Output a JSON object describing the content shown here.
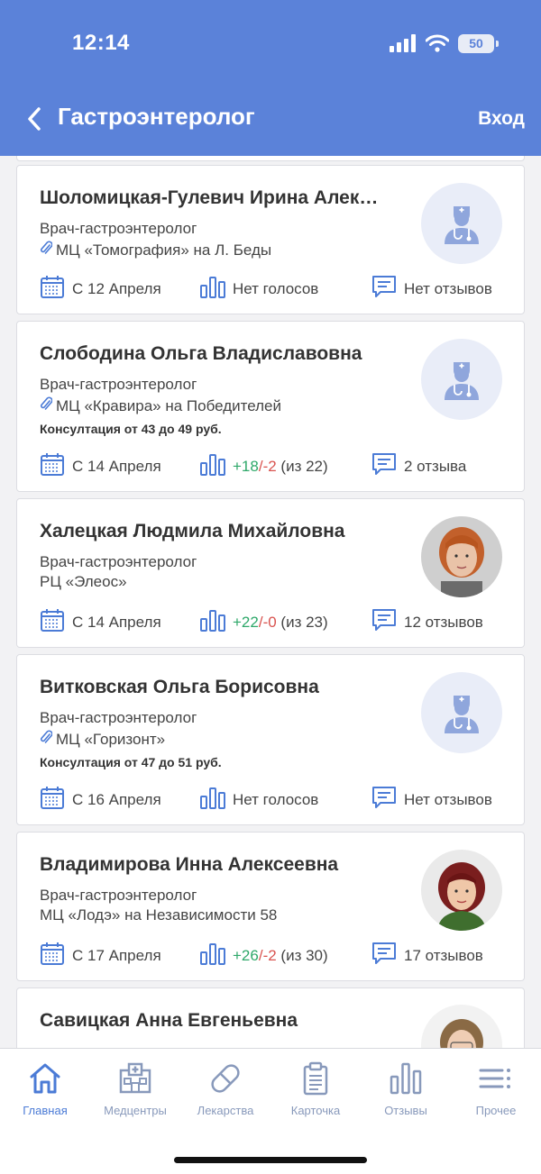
{
  "status_bar": {
    "time": "12:14",
    "battery": "50"
  },
  "nav": {
    "title": "Гастроэнтеролог",
    "login": "Вход"
  },
  "colors": {
    "header_bg": "#5b82d9",
    "accent": "#4b7bd6",
    "positive": "#2fa86a",
    "negative": "#d9534f"
  },
  "doctors": [
    {
      "name": "Шоломицкая-Гулевич Ирина Алек…",
      "specialty": "Врач-гастроэнтеролог",
      "clinic": "МЦ «Томография» на Л. Беды",
      "clinic_icon": "paperclip-icon",
      "price": "",
      "date": "С 12 Апреля",
      "votes": "Нет голосов",
      "votes_up": "",
      "votes_down": "",
      "votes_total": "",
      "reviews": "Нет отзывов",
      "avatar": "doctor-placeholder-icon"
    },
    {
      "name": "Слободина Ольга Владиславовна",
      "specialty": "Врач-гастроэнтеролог",
      "clinic": "МЦ «Кравира» на Победителей",
      "clinic_icon": "paperclip-icon",
      "price": "Консултация от 43 до 49 руб.",
      "date": "С 14 Апреля",
      "votes": "",
      "votes_up": "+18",
      "votes_down": "/-2",
      "votes_total": " (из 22)",
      "reviews": "2 отзыва",
      "avatar": "doctor-placeholder-icon"
    },
    {
      "name": "Халецкая Людмила Михайловна",
      "specialty": "Врач-гастроэнтеролог",
      "clinic": "РЦ «Элеос»",
      "clinic_icon": "",
      "price": "",
      "date": "С 14 Апреля",
      "votes": "",
      "votes_up": "+22",
      "votes_down": "/-0",
      "votes_total": " (из 23)",
      "reviews": "12 отзывов",
      "avatar": "doctor-photo"
    },
    {
      "name": "Витковская Ольга Борисовна",
      "specialty": "Врач-гастроэнтеролог",
      "clinic": "МЦ «Горизонт»",
      "clinic_icon": "paperclip-icon",
      "price": "Консултация от 47 до 51 руб.",
      "date": "С 16 Апреля",
      "votes": "Нет голосов",
      "votes_up": "",
      "votes_down": "",
      "votes_total": "",
      "reviews": "Нет отзывов",
      "avatar": "doctor-placeholder-icon"
    },
    {
      "name": "Владимирова Инна Алексеевна",
      "specialty": "Врач-гастроэнтеролог",
      "clinic": "МЦ «Лодэ» на Независимости 58",
      "clinic_icon": "",
      "price": "",
      "date": "С 17 Апреля",
      "votes": "",
      "votes_up": "+26",
      "votes_down": "/-2",
      "votes_total": " (из 30)",
      "reviews": "17 отзывов",
      "avatar": "doctor-photo"
    },
    {
      "name": "Савицкая Анна Евгеньевна",
      "specialty": "",
      "clinic": "",
      "clinic_icon": "",
      "price": "",
      "date": "",
      "votes": "",
      "votes_up": "",
      "votes_down": "",
      "votes_total": "",
      "reviews": "",
      "avatar": "doctor-photo"
    }
  ],
  "tabbar": {
    "items": [
      {
        "label": "Главная",
        "icon": "home-icon",
        "active": true
      },
      {
        "label": "Медцентры",
        "icon": "hospital-icon",
        "active": false
      },
      {
        "label": "Лекарства",
        "icon": "pill-icon",
        "active": false
      },
      {
        "label": "Карточка",
        "icon": "clipboard-icon",
        "active": false
      },
      {
        "label": "Отзывы",
        "icon": "bar-chart-icon",
        "active": false
      },
      {
        "label": "Прочее",
        "icon": "menu-icon",
        "active": false
      }
    ]
  }
}
